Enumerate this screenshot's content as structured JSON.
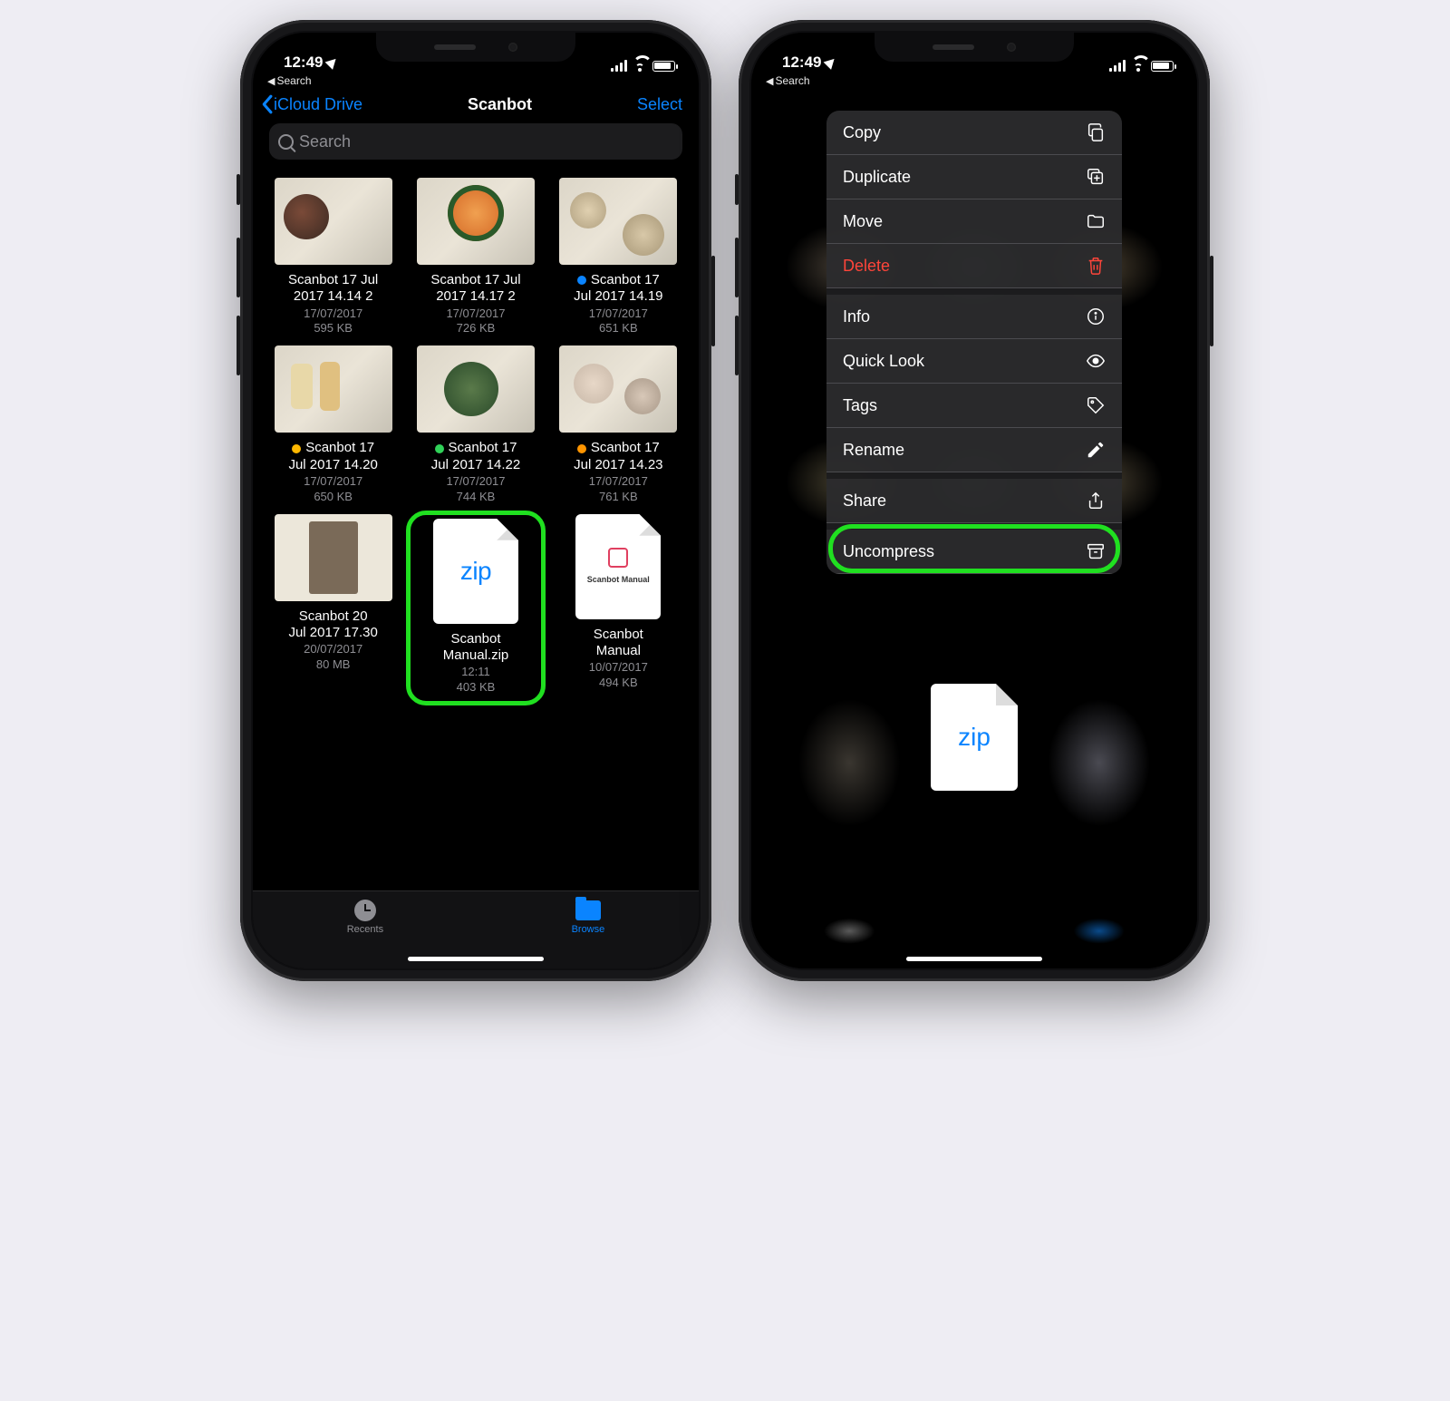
{
  "status": {
    "time": "12:49",
    "back_app": "Search"
  },
  "colors": {
    "accent": "#0a84ff",
    "danger": "#ff453a",
    "highlight": "#20e020"
  },
  "left": {
    "nav": {
      "back": "iCloud Drive",
      "title": "Scanbot",
      "action": "Select"
    },
    "search_placeholder": "Search",
    "files": [
      {
        "name_l1": "Scanbot 17 Jul",
        "name_l2": "2017 14.14 2",
        "date": "17/07/2017",
        "size": "595 KB",
        "tag": null,
        "thumb": "food1"
      },
      {
        "name_l1": "Scanbot 17 Jul",
        "name_l2": "2017 14.17 2",
        "date": "17/07/2017",
        "size": "726 KB",
        "tag": null,
        "thumb": "food2"
      },
      {
        "name_l1": "Scanbot 17",
        "name_l2": "Jul 2017 14.19",
        "date": "17/07/2017",
        "size": "651 KB",
        "tag": "#0a84ff",
        "thumb": "food3"
      },
      {
        "name_l1": "Scanbot 17",
        "name_l2": "Jul 2017 14.20",
        "date": "17/07/2017",
        "size": "650 KB",
        "tag": "#ffb800",
        "thumb": "food4"
      },
      {
        "name_l1": "Scanbot 17",
        "name_l2": "Jul 2017 14.22",
        "date": "17/07/2017",
        "size": "744 KB",
        "tag": "#30d158",
        "thumb": "food5"
      },
      {
        "name_l1": "Scanbot 17",
        "name_l2": "Jul 2017 14.23",
        "date": "17/07/2017",
        "size": "761 KB",
        "tag": "#ff9500",
        "thumb": "food6"
      },
      {
        "name_l1": "Scanbot 20",
        "name_l2": "Jul 2017 17.30",
        "date": "20/07/2017",
        "size": "80 MB",
        "tag": null,
        "thumb": "book"
      },
      {
        "name_l1": "Scanbot",
        "name_l2": "Manual.zip",
        "date": "12:11",
        "size": "403 KB",
        "tag": null,
        "thumb": "zip",
        "highlighted": true
      },
      {
        "name_l1": "Scanbot",
        "name_l2": "Manual",
        "date": "10/07/2017",
        "size": "494 KB",
        "tag": null,
        "thumb": "folder",
        "folder_label": "Scanbot Manual"
      }
    ],
    "tabs": {
      "recents": "Recents",
      "browse": "Browse"
    }
  },
  "right": {
    "menu": [
      {
        "label": "Copy",
        "icon": "copy"
      },
      {
        "label": "Duplicate",
        "icon": "duplicate"
      },
      {
        "label": "Move",
        "icon": "folder"
      },
      {
        "label": "Delete",
        "icon": "trash",
        "danger": true
      },
      {
        "label": "Info",
        "icon": "info",
        "sep": true
      },
      {
        "label": "Quick Look",
        "icon": "eye"
      },
      {
        "label": "Tags",
        "icon": "tag"
      },
      {
        "label": "Rename",
        "icon": "pencil"
      },
      {
        "label": "Share",
        "icon": "share",
        "sep": true
      },
      {
        "label": "Uncompress",
        "icon": "archive",
        "sep": true,
        "highlighted": true
      }
    ],
    "preview_label": "zip"
  }
}
